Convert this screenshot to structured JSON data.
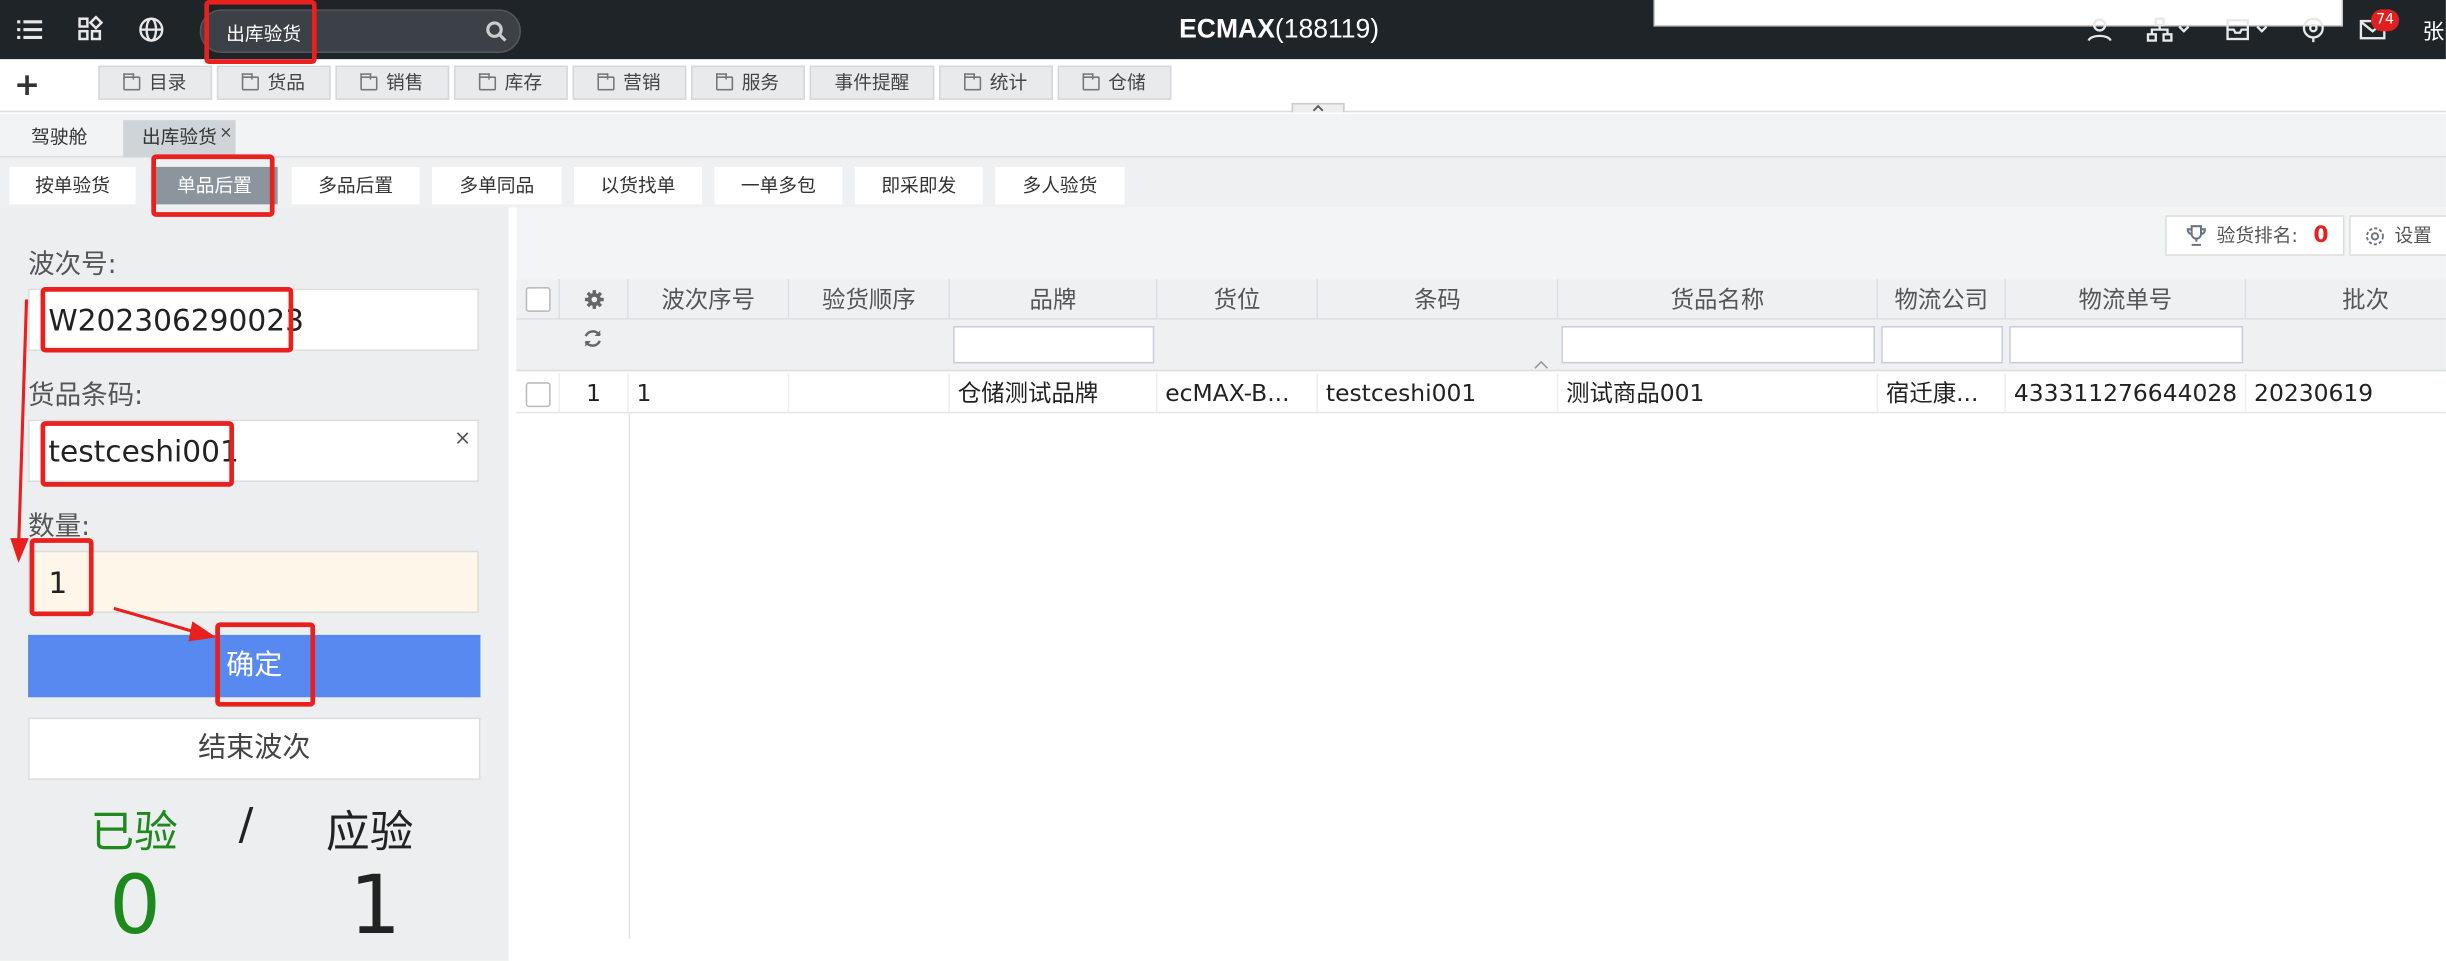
{
  "topbar": {
    "search_value": "出库验货",
    "brand": "ECMAX",
    "account": "(188119)",
    "badge": "74",
    "user": "张",
    "colors": {
      "bg": "#1f2428",
      "badge": "#e02020"
    }
  },
  "nav": {
    "items": [
      "目录",
      "货品",
      "销售",
      "库存",
      "营销",
      "服务",
      "事件提醒",
      "统计",
      "仓储"
    ]
  },
  "tabs": [
    {
      "label": "驾驶舱"
    },
    {
      "label": "出库验货"
    }
  ],
  "tab_close": "×",
  "subtabs": [
    "按单验货",
    "单品后置",
    "多品后置",
    "多单同品",
    "以货找单",
    "一单多包",
    "即采即发",
    "多人验货"
  ],
  "form": {
    "batch_label": "波次号:",
    "batch_value": "W202306290023",
    "barcode_label": "货品条码:",
    "barcode_value": "testceshi001",
    "clear": "×",
    "qty_label": "数量:",
    "qty_value": "1",
    "confirm": "确定",
    "end_batch": "结束波次"
  },
  "stats": {
    "checked_label": "已验",
    "sep": "/",
    "expected_label": "应验",
    "checked": "0",
    "expected": "1",
    "colors": {
      "checked": "#1e8a1e",
      "expected": "#222222"
    }
  },
  "toolbar": {
    "rank_label": "验货排名:",
    "rank_value": "0",
    "settings": "设置"
  },
  "table": {
    "columns": [
      "波次序号",
      "验货顺序",
      "品牌",
      "货位",
      "条码",
      "货品名称",
      "物流公司",
      "物流单号",
      "批次"
    ],
    "rows": [
      {
        "row_no": "1",
        "cells": [
          "1",
          "",
          "仓储测试品牌",
          "ecMAX-B...",
          "testceshi001",
          "测试商品001",
          "宿迁康...",
          "433311276644028",
          "20230619"
        ]
      }
    ]
  },
  "accent": "#5889f0"
}
